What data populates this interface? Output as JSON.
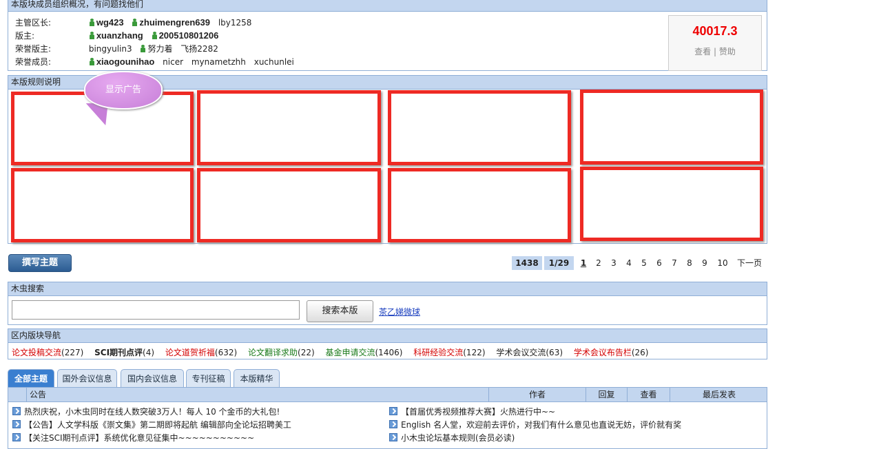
{
  "moderators": {
    "header": "本版块成员组织概况，有问题找他们",
    "rows": [
      {
        "label": "主管区长:",
        "users": [
          "wg423",
          "zhuimengren639",
          "lby1258"
        ]
      },
      {
        "label": "版主:",
        "users": [
          "xuanzhang",
          "200510801206"
        ]
      },
      {
        "label": "荣誉版主:",
        "users": [
          "bingyulin3",
          "努力着",
          "飞扬2282"
        ]
      },
      {
        "label": "荣誉成员:",
        "users": [
          "xiaogounihao",
          "nicer",
          "mynametzhh",
          "xuchunlei"
        ]
      }
    ],
    "credit": "40017.3",
    "credit_view": "查看",
    "credit_sep": "|",
    "credit_sponsor": "赞助"
  },
  "rules": {
    "header": "本版规则说明",
    "ad_bubble": "显示广告"
  },
  "toolbar": {
    "post_label": "撰写主题"
  },
  "pager": {
    "total": "1438",
    "page_of": "1/29",
    "pages": [
      "1",
      "2",
      "3",
      "4",
      "5",
      "6",
      "7",
      "8",
      "9",
      "10"
    ],
    "next": "下一页"
  },
  "search": {
    "header": "木虫搜索",
    "button": "搜索本版",
    "link": "茶乙娣微球"
  },
  "nav": {
    "header": "区内版块导航",
    "items": [
      {
        "name": "论文投稿交流",
        "count": "(227)",
        "color": "#d40000"
      },
      {
        "name": "SCI期刊点评",
        "count": "(4)",
        "color": "#222222"
      },
      {
        "name": "论文道贺祈福",
        "count": "(632)",
        "color": "#d40000"
      },
      {
        "name": "论文翻译求助",
        "count": "(22)",
        "color": "#1a7a1a"
      },
      {
        "name": "基金申请交流",
        "count": "(1406)",
        "color": "#1a7a1a"
      },
      {
        "name": "科研经验交流",
        "count": "(122)",
        "color": "#d40000"
      },
      {
        "name": "学术会议交流",
        "count": "(63)",
        "color": "#222222"
      },
      {
        "name": "学术会议布告栏",
        "count": "(26)",
        "color": "#d40000"
      }
    ]
  },
  "tabs": [
    "全部主题",
    "国外会议信息",
    "国内会议信息",
    "专刊征稿",
    "本版精华"
  ],
  "list": {
    "columns": [
      "公告",
      "作者",
      "回复",
      "查看",
      "最后发表"
    ],
    "left": [
      "热烈庆祝，小木虫同时在线人数突破3万人！每人 10 个金币的大礼包!",
      "【公告】人文学科版《崇文集》第二期即将起航 编辑部向全论坛招聘美工",
      "【关注SCI期刊点评】系统优化意见征集中~~~~~~~~~~~"
    ],
    "right": [
      "【首届优秀视频推荐大赛】火热进行中~~",
      "English 名人堂，欢迎前去评价，对我们有什么意见也直说无妨，评价就有奖",
      "小木虫论坛基本规则(会员必读)"
    ]
  }
}
